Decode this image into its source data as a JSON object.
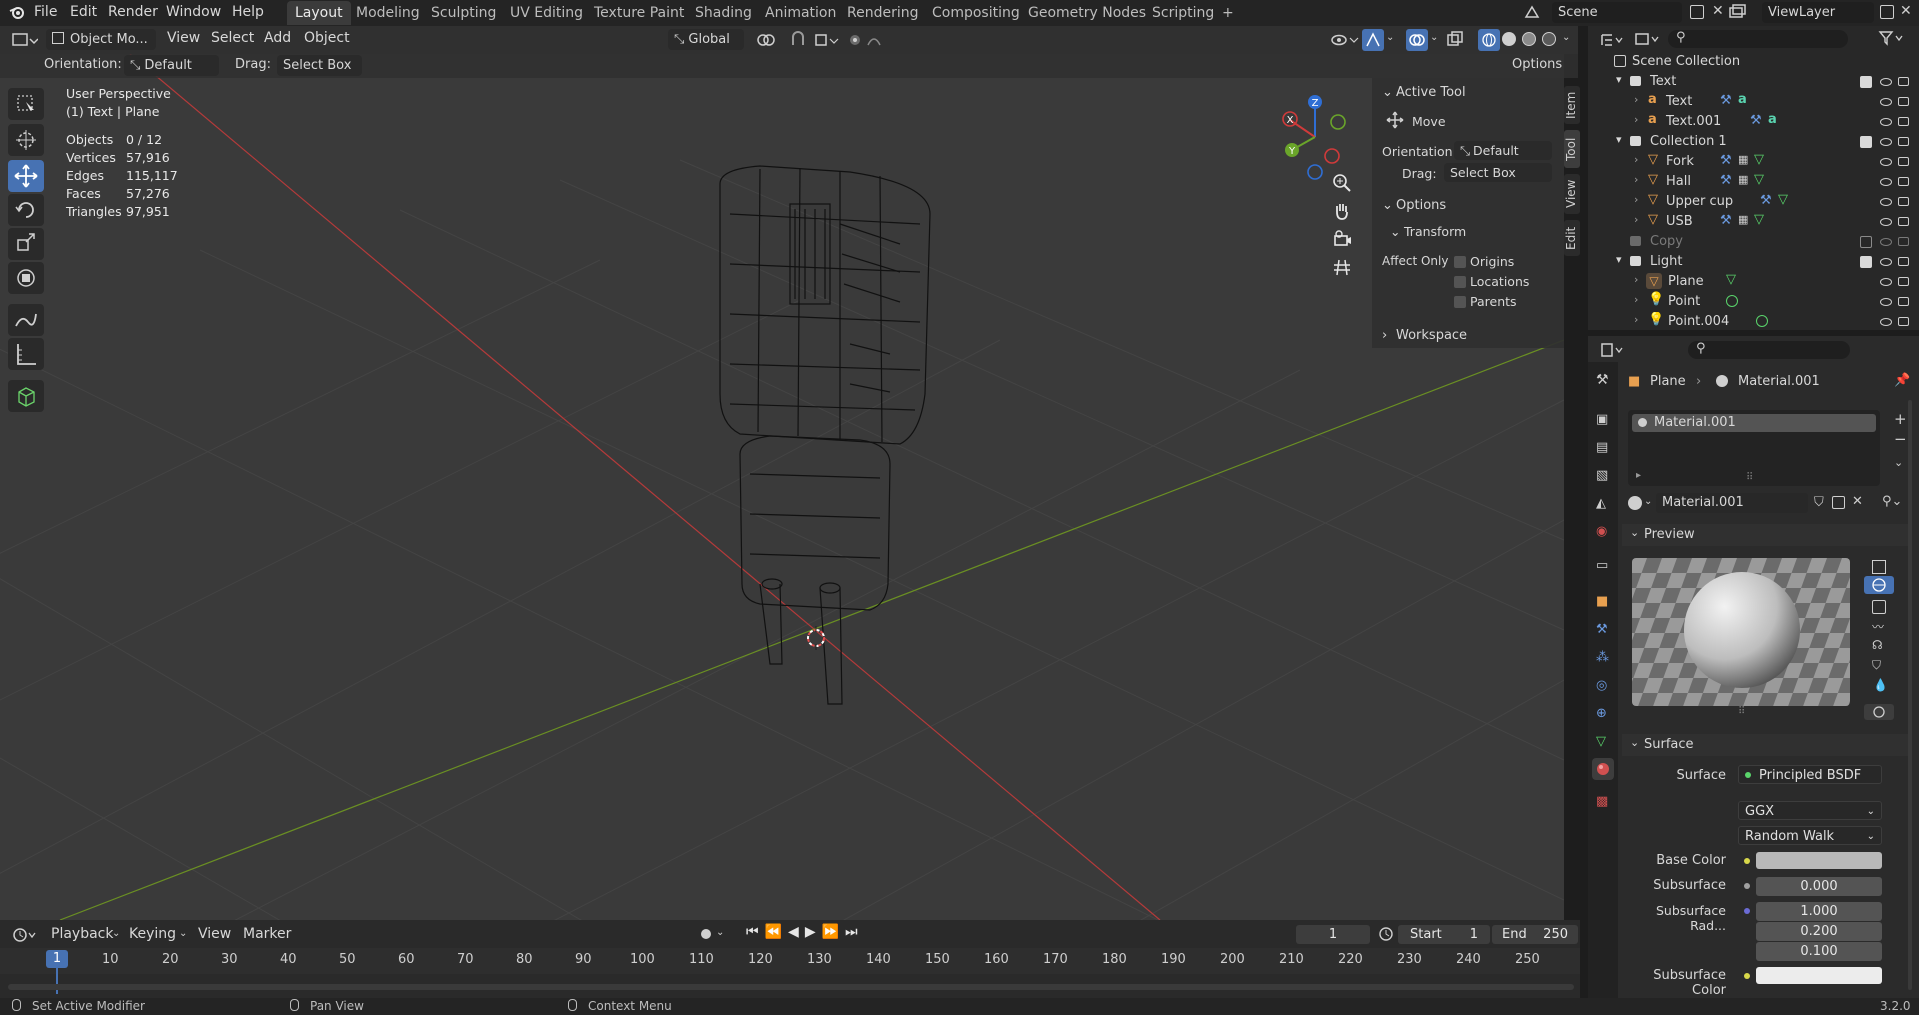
{
  "topbar": {
    "menus": [
      "File",
      "Edit",
      "Render",
      "Window",
      "Help"
    ],
    "workspaces": [
      "Layout",
      "Modeling",
      "Sculpting",
      "UV Editing",
      "Texture Paint",
      "Shading",
      "Animation",
      "Rendering",
      "Compositing",
      "Geometry Nodes",
      "Scripting"
    ],
    "active_workspace": "Layout",
    "add_tab": "+",
    "scene": "Scene",
    "view_layer": "ViewLayer"
  },
  "viewport_header": {
    "mode": "Object Mo...",
    "menus": [
      "View",
      "Select",
      "Add",
      "Object"
    ],
    "transform_orientation": "Global"
  },
  "tool_settings": {
    "orientation_label": "Orientation:",
    "orientation_value": "Default",
    "drag_label": "Drag:",
    "drag_value": "Select Box",
    "options": "Options"
  },
  "overlay_info": {
    "perspective": "User Perspective",
    "object_context": "(1) Text | Plane",
    "stats": [
      {
        "label": "Objects",
        "value": "0 / 12"
      },
      {
        "label": "Vertices",
        "value": "57,916"
      },
      {
        "label": "Edges",
        "value": "115,117"
      },
      {
        "label": "Faces",
        "value": "57,276"
      },
      {
        "label": "Triangles",
        "value": "97,951"
      }
    ]
  },
  "gizmo": {
    "x": "X",
    "y": "Y",
    "z": "Z"
  },
  "npanel": {
    "active_tool": "Active Tool",
    "tool_name": "Move",
    "orientation_label": "Orientation",
    "orientation_value": "Default",
    "drag_label": "Drag:",
    "drag_value": "Select Box",
    "options": "Options",
    "transform": "Transform",
    "affect_only": "Affect Only",
    "origins": "Origins",
    "locations": "Locations",
    "parents": "Parents",
    "workspace": "Workspace",
    "tabs": [
      "Item",
      "Tool",
      "View",
      "Edit"
    ]
  },
  "timeline": {
    "menus": [
      "Playback",
      "Keying",
      "View",
      "Marker"
    ],
    "current_frame": "1",
    "start_label": "Start",
    "start": "1",
    "end_label": "End",
    "end": "250",
    "ticks": [
      "1",
      "10",
      "20",
      "30",
      "40",
      "50",
      "60",
      "70",
      "80",
      "90",
      "100",
      "110",
      "120",
      "130",
      "140",
      "150",
      "160",
      "170",
      "180",
      "190",
      "200",
      "210",
      "220",
      "230",
      "240",
      "250"
    ]
  },
  "statusbar": {
    "left": "Set Active Modifier",
    "middle": "Pan View",
    "right": "Context Menu",
    "version": "3.2.0"
  },
  "outliner": {
    "root": "Scene Collection",
    "rows": [
      {
        "name": "Text",
        "kind": "collection"
      },
      {
        "name": "Text",
        "kind": "object"
      },
      {
        "name": "Text.001",
        "kind": "object"
      },
      {
        "name": "Collection 1",
        "kind": "collection"
      },
      {
        "name": "Fork",
        "kind": "object"
      },
      {
        "name": "Hall",
        "kind": "object"
      },
      {
        "name": "Upper cup",
        "kind": "object"
      },
      {
        "name": "USB",
        "kind": "object"
      },
      {
        "name": "Copy",
        "kind": "collection-disabled"
      },
      {
        "name": "Light",
        "kind": "collection"
      },
      {
        "name": "Plane",
        "kind": "object"
      },
      {
        "name": "Point",
        "kind": "light"
      },
      {
        "name": "Point.004",
        "kind": "light"
      }
    ]
  },
  "properties": {
    "breadcrumb_object": "Plane",
    "breadcrumb_material": "Material.001",
    "slot": "Material.001",
    "material_name": "Material.001",
    "preview": "Preview",
    "surface_section": "Surface",
    "surface_label": "Surface",
    "surface_value": "Principled BSDF",
    "distribution": "GGX",
    "subsurface_method": "Random Walk",
    "base_color_label": "Base Color",
    "subsurface_label": "Subsurface",
    "subsurface_value": "0.000",
    "subsurface_radius_label": "Subsurface Rad...",
    "subsurface_radius": [
      "1.000",
      "0.200",
      "0.100"
    ],
    "subsurface_color_label": "Subsurface Color"
  }
}
